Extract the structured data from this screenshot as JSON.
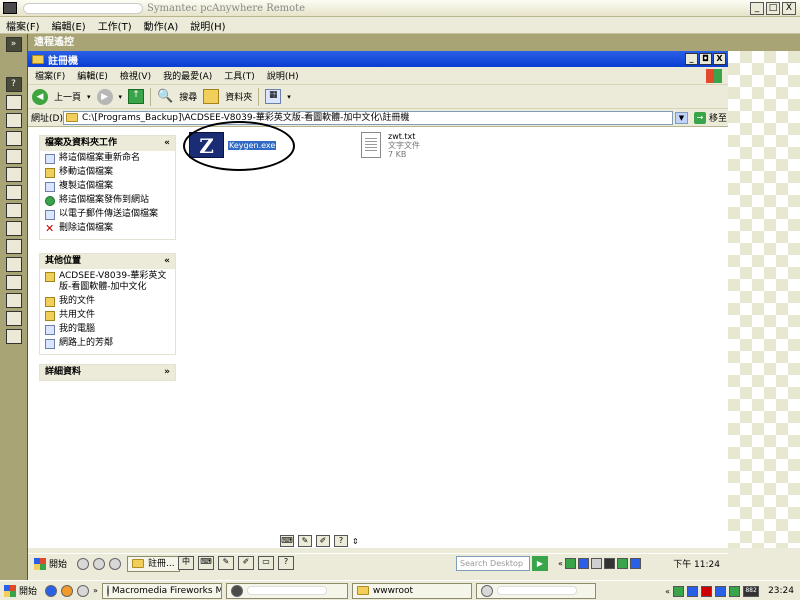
{
  "outer_window": {
    "title": "Symantec pcAnywhere Remote",
    "buttons": [
      "_",
      "□",
      "X"
    ],
    "menu": [
      "檔案(F)",
      "編輯(E)",
      "工作(T)",
      "動作(A)",
      "說明(H)"
    ],
    "panel_label": "遠程遙控"
  },
  "explorer": {
    "title": "註冊機",
    "buttons": [
      "_",
      "◘",
      "X"
    ],
    "menu": [
      "檔案(F)",
      "編輯(E)",
      "檢視(V)",
      "我的最愛(A)",
      "工具(T)",
      "說明(H)"
    ],
    "toolbar": {
      "back": "上一頁",
      "search": "搜尋",
      "folders": "資料夾"
    },
    "address_label": "網址(D)",
    "address_value": "C:\\[Programs_Backup]\\ACDSEE-V8039-華彩英文版-看圖軟體-加中文化\\註冊機",
    "go_label": "移至"
  },
  "tasks_panel": {
    "title": "檔案及資料夾工作",
    "items": [
      "將這個檔案重新命名",
      "移動這個檔案",
      "複製這個檔案",
      "將這個檔案發佈到網站",
      "以電子郵件傳送這個檔案",
      "刪除這個檔案"
    ]
  },
  "other_places": {
    "title": "其他位置",
    "items": [
      "ACDSEE-V8039-華彩英文版-看圖軟體-加中文化",
      "我的文件",
      "共用文件",
      "我的電腦",
      "網路上的芳鄰"
    ]
  },
  "details_panel": {
    "title": "詳細資料"
  },
  "files": [
    {
      "name": "Keygen.exe",
      "selected": true
    },
    {
      "name": "zwt.txt",
      "type": "文字文件",
      "size": "7 KB"
    }
  ],
  "remote_taskbar": {
    "start": "開始",
    "window_button": "註冊...",
    "search_placeholder": "Search Desktop",
    "clock": "下午 11:24"
  },
  "local_taskbar": {
    "start": "開始",
    "buttons": [
      "Macromedia Fireworks M...",
      "wwwroot"
    ],
    "clock": "23:24",
    "tray_badge": "882"
  },
  "colors": {
    "accent": "#0a3dd0",
    "selection": "#316ac5",
    "sidebar": "#a8a475"
  }
}
